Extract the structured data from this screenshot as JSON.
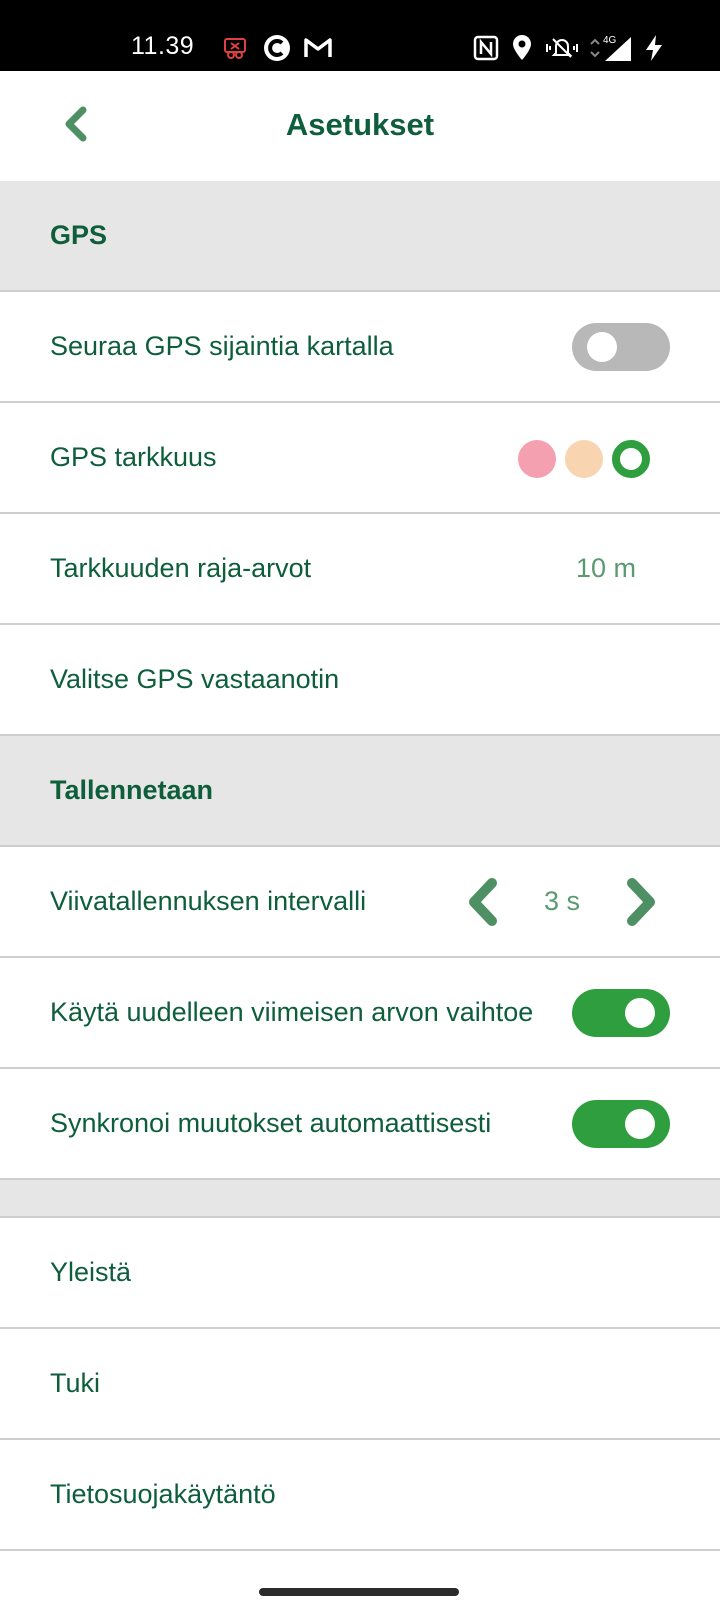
{
  "status_bar": {
    "time": "11.39",
    "icons": [
      "screen-record-icon",
      "c-app-icon",
      "gmail-icon",
      "nfc-icon",
      "location-icon",
      "vibrate-silent-icon",
      "network-4g-icon",
      "signal-icon",
      "charging-icon"
    ],
    "network_label": "4G"
  },
  "app_bar": {
    "title": "Asetukset",
    "back_icon": "chevron-left-icon"
  },
  "sections": {
    "gps_header": "GPS",
    "follow_gps": {
      "label": "Seuraa GPS sijaintia kartalla",
      "enabled": false
    },
    "gps_accuracy": {
      "label": "GPS tarkkuus",
      "levels": [
        "#f4a0b0",
        "#f8d4b0",
        "#2e9e3e"
      ],
      "selected_index": 2
    },
    "accuracy_threshold": {
      "label": "Tarkkuuden raja-arvot",
      "value": "10 m"
    },
    "gps_receiver": {
      "label": "Valitse GPS vastaanotin"
    },
    "saving_header": "Tallennetaan",
    "line_interval": {
      "label": "Viivatallennuksen intervalli",
      "value": "3 s"
    },
    "reuse_last_value": {
      "label": "Käytä uudelleen viimeisen arvon vaihtoe",
      "enabled": true
    },
    "auto_sync": {
      "label": "Synkronoi muutokset automaattisesti",
      "enabled": true
    },
    "general": {
      "label": "Yleistä"
    },
    "support": {
      "label": "Tuki"
    },
    "privacy": {
      "label": "Tietosuojakäytäntö"
    }
  },
  "colors": {
    "primary_text": "#0e5e3c",
    "accent_green": "#2e9e3e",
    "value_text": "#5a9a70",
    "header_bg": "#e6e6e6",
    "toggle_off": "#b8b8b8"
  }
}
